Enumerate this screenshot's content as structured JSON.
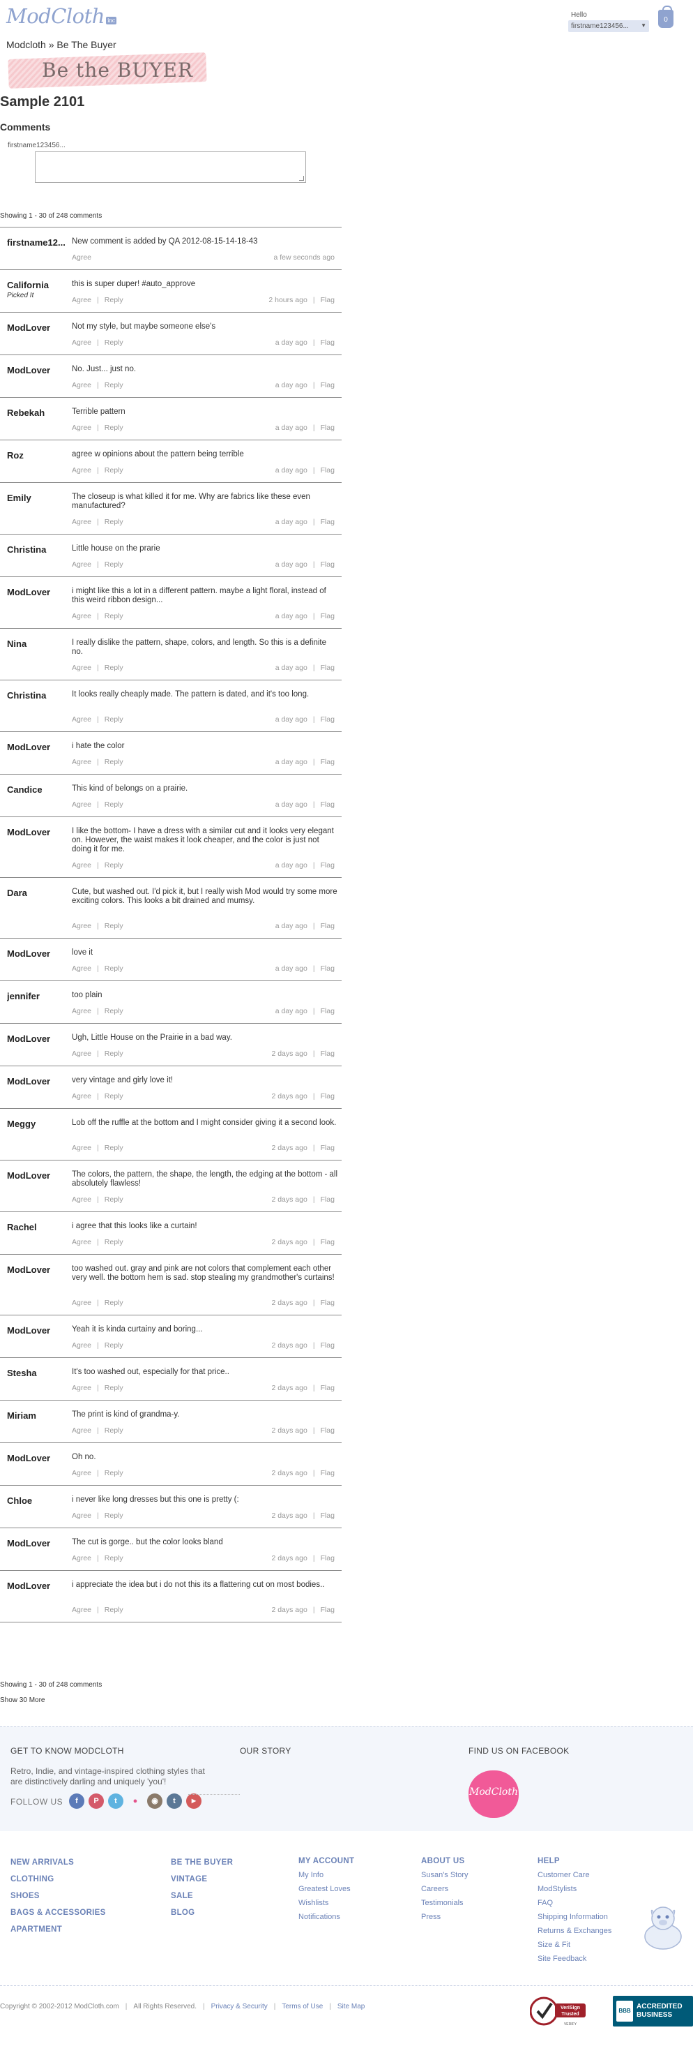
{
  "header": {
    "logo": "ModCloth",
    "logo_tag": "inc",
    "hello": "Hello",
    "user": "firstname123456...",
    "bag_count": "0"
  },
  "breadcrumb": "Modcloth » Be The Buyer",
  "banner": "Be the BUYER",
  "page_title": "Sample 2101",
  "comments_heading": "Comments",
  "comment_form": {
    "user": "firstname123456..."
  },
  "showing_text": "Showing 1 - 30 of 248 comments",
  "comments": [
    {
      "name": "firstname12...",
      "text": "New comment is added by QA 2012-08-15-14-18-43",
      "time": "a few seconds ago",
      "own": true
    },
    {
      "name": "California",
      "picked": "Picked It",
      "text": "this is super duper! #auto_approve",
      "time": "2 hours ago"
    },
    {
      "name": "ModLover",
      "text": "Not my style, but maybe someone else's",
      "time": "a day ago"
    },
    {
      "name": "ModLover",
      "text": "No. Just... just no.",
      "time": "a day ago"
    },
    {
      "name": "Rebekah",
      "text": "Terrible pattern",
      "time": "a day ago"
    },
    {
      "name": "Roz",
      "text": "agree w opinions about the pattern being terrible",
      "time": "a day ago"
    },
    {
      "name": "Emily",
      "text": "The closeup is what killed it for me. Why are fabrics like these even manufactured?",
      "time": "a day ago"
    },
    {
      "name": "Christina",
      "text": "Little house on the prarie",
      "time": "a day ago"
    },
    {
      "name": "ModLover",
      "text": "i might like this a lot in a different pattern. maybe a light floral, instead of this weird ribbon design...",
      "time": "a day ago"
    },
    {
      "name": "Nina",
      "text": "I really dislike the pattern, shape, colors, and length. So this is a definite no.",
      "time": "a day ago"
    },
    {
      "name": "Christina",
      "text": "It looks really cheaply made. The pattern is dated, and it's too long.",
      "time": "a day ago"
    },
    {
      "name": "ModLover",
      "text": "i hate the color",
      "time": "a day ago"
    },
    {
      "name": "Candice",
      "text": "This kind of belongs on a prairie.",
      "time": "a day ago"
    },
    {
      "name": "ModLover",
      "text": "I like the bottom- I have a dress with a similar cut and it looks very elegant on. However, the waist makes it look cheaper, and the color is just not doing it for me.",
      "time": "a day ago"
    },
    {
      "name": "Dara",
      "text": "Cute, but washed out. I'd pick it, but I really wish Mod would try some more exciting colors. This looks a bit drained and mumsy.",
      "time": "a day ago"
    },
    {
      "name": "ModLover",
      "text": "love it",
      "time": "a day ago"
    },
    {
      "name": "jennifer",
      "text": "too plain",
      "time": "a day ago"
    },
    {
      "name": "ModLover",
      "text": "Ugh, Little House on the Prairie in a bad way.",
      "time": "2 days ago"
    },
    {
      "name": "ModLover",
      "text": "very vintage and girly love it!",
      "time": "2 days ago"
    },
    {
      "name": "Meggy",
      "text": "Lob off the ruffle at the bottom and I might consider giving it a second look.",
      "time": "2 days ago"
    },
    {
      "name": "ModLover",
      "text": "The colors, the pattern, the shape, the length, the edging at the bottom - all absolutely flawless!",
      "time": "2 days ago"
    },
    {
      "name": "Rachel",
      "text": "i agree that this looks like a curtain!",
      "time": "2 days ago"
    },
    {
      "name": "ModLover",
      "text": "too washed out. gray and pink are not colors that complement each other very well. the bottom hem is sad. stop stealing my grandmother's curtains!",
      "time": "2 days ago"
    },
    {
      "name": "ModLover",
      "text": "Yeah it is kinda curtainy and boring...",
      "time": "2 days ago"
    },
    {
      "name": "Stesha",
      "text": "It's too washed out, especially for that price..",
      "time": "2 days ago"
    },
    {
      "name": "Miriam",
      "text": "The print is kind of grandma-y.",
      "time": "2 days ago"
    },
    {
      "name": "ModLover",
      "text": "Oh no.",
      "time": "2 days ago"
    },
    {
      "name": "Chloe",
      "text": "i never like long dresses but this one is pretty (:",
      "time": "2 days ago"
    },
    {
      "name": "ModLover",
      "text": "The cut is gorge.. but the color looks bland",
      "time": "2 days ago"
    },
    {
      "name": "ModLover",
      "text": "i appreciate the idea but i do not this its a flattering cut on most bodies..",
      "time": "2 days ago"
    }
  ],
  "actions": {
    "agree": "Agree",
    "reply": "Reply",
    "flag": "Flag"
  },
  "show_more": "Show 30 More",
  "footer": {
    "get_to_know": "GET TO KNOW MODCLOTH",
    "about": "Retro, Indie, and vintage-inspired clothing styles that are distinctively darling and uniquely 'you'!",
    "follow_us": "FOLLOW US",
    "our_story": "OUR STORY",
    "find_us": "FIND US ON FACEBOOK",
    "fb_logo": "ModCloth",
    "col1": [
      "NEW ARRIVALS",
      "CLOTHING",
      "SHOES",
      "BAGS & ACCESSORIES",
      "APARTMENT"
    ],
    "col2": [
      "BE THE BUYER",
      "VINTAGE",
      "SALE",
      "BLOG"
    ],
    "my_account": {
      "heading": "MY ACCOUNT",
      "links": [
        "My Info",
        "Greatest Loves",
        "Wishlists",
        "Notifications"
      ]
    },
    "about_us": {
      "heading": "ABOUT US",
      "links": [
        "Susan's Story",
        "Careers",
        "Testimonials",
        "Press"
      ]
    },
    "help": {
      "heading": "HELP",
      "links": [
        "Customer Care",
        "ModStylists",
        "FAQ",
        "Shipping Information",
        "Returns & Exchanges",
        "Size & Fit",
        "Site Feedback"
      ]
    },
    "copyright": "Copyright © 2002-2012 ModCloth.com",
    "rights": "All Rights Reserved.",
    "privacy": "Privacy & Security",
    "terms": "Terms of Use",
    "sitemap": "Site Map",
    "verisign": "VeriSign Trusted",
    "verisign_verify": "VERIFY",
    "bbb_seal": "BBB",
    "bbb": "ACCREDITED BUSINESS"
  },
  "colors": {
    "accent": "#6b82b7",
    "logo": "#8fa3cf",
    "band": "#f3f6fb"
  }
}
